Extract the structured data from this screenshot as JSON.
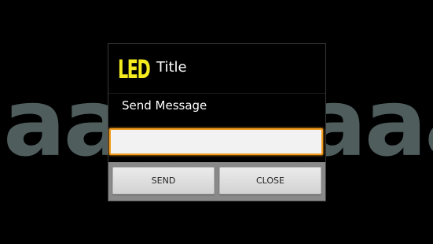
{
  "background": {
    "text": "aaaaaaaaa"
  },
  "dialog": {
    "icon_text": "LED",
    "title": "Title",
    "message": "Send Message",
    "input": {
      "value": "",
      "placeholder": ""
    },
    "buttons": {
      "send_label": "SEND",
      "close_label": "CLOSE"
    }
  },
  "colors": {
    "screen_background": "#000000",
    "background_text": "#4f5d5d",
    "led_icon": "#f4ec1f",
    "input_focus_border": "#f39c1e",
    "button_bar": "#898989"
  }
}
